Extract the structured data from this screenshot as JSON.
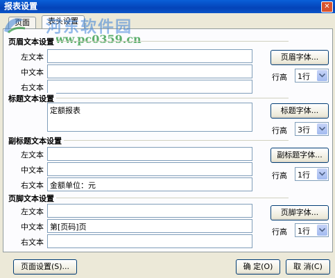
{
  "window": {
    "title": "报表设置",
    "close_glyph": "✕"
  },
  "watermark": {
    "line1": "河东软件园",
    "line2": "www.pc0359.cn"
  },
  "tabs": [
    {
      "label": "页面"
    },
    {
      "label": "表头设置"
    }
  ],
  "labels": {
    "left": "左文本",
    "center": "中文本",
    "right": "右文本",
    "row_height": "行高"
  },
  "sections": {
    "header": {
      "title": "页眉文本设置",
      "left": "",
      "center": "",
      "right": "",
      "font_button": "页眉字体...",
      "row_height": "1行"
    },
    "title": {
      "title": "标题文本设置",
      "text": "定额报表",
      "font_button": "标题字体...",
      "row_height": "3行"
    },
    "subtitle": {
      "title": "副标题文本设置",
      "left": "",
      "center": "",
      "right": "金额单位：元",
      "font_button": "副标题字体...",
      "row_height": "1行"
    },
    "footer": {
      "title": "页脚文本设置",
      "left": "",
      "center": "第[页码]页",
      "right": "",
      "font_button": "页脚字体...",
      "row_height": "1行"
    }
  },
  "buttons": {
    "page_setup": "页面设置(S)...",
    "ok": "确 定(O)",
    "cancel": "取 消(C)"
  },
  "colors": {
    "titlebar": "#0a5fd8",
    "dialog_bg": "#ece9d8",
    "border": "#7f9db9"
  }
}
